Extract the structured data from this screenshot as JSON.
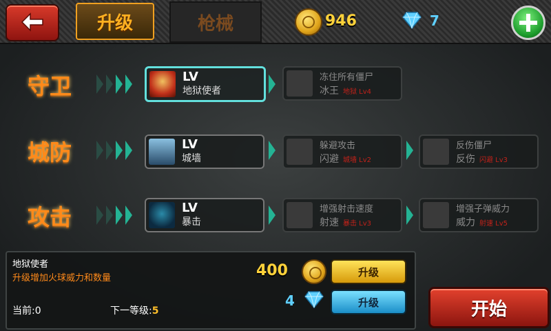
{
  "topbar": {
    "back_icon": "back-arrow-icon",
    "tabs": [
      {
        "label": "升级"
      },
      {
        "label": "枪械"
      }
    ],
    "coins": "946",
    "gems": "7",
    "plus_icon": "plus-icon"
  },
  "rows": [
    {
      "title": "守卫",
      "current": {
        "lv": "LV",
        "name": "地狱使者"
      },
      "locked": [
        {
          "line1": "冻住所有僵尸",
          "line2": "冰王",
          "req": "地狱 Lv4"
        }
      ]
    },
    {
      "title": "城防",
      "current": {
        "lv": "LV",
        "name": "城墙"
      },
      "locked": [
        {
          "line1": "躲避攻击",
          "line2": "闪避",
          "req": "城墙 Lv2"
        },
        {
          "line1": "反伤僵尸",
          "line2": "反伤",
          "req": "闪避 Lv3"
        }
      ]
    },
    {
      "title": "攻击",
      "current": {
        "lv": "LV",
        "name": "暴击"
      },
      "locked": [
        {
          "line1": "增强射击速度",
          "line2": "射速",
          "req": "暴击 Lv3"
        },
        {
          "line1": "增强子弹威力",
          "line2": "威力",
          "req": "射速 Lv5"
        }
      ]
    }
  ],
  "detail": {
    "name": "地狱使者",
    "description": "升级增加火球威力和数量",
    "current_label": "当前:",
    "current_value": "0",
    "next_label": "下一等级:",
    "next_value": "5",
    "coin_cost": "400",
    "gem_cost": "4",
    "upgrade_coin_label": "升级",
    "upgrade_gem_label": "升级"
  },
  "start_label": "开始",
  "colors": {
    "accent_orange": "#ff8a1a",
    "selected_border": "#63e0dd",
    "arrow": "#24b394",
    "coin": "#ffd23a",
    "gem": "#5fd0ff"
  }
}
